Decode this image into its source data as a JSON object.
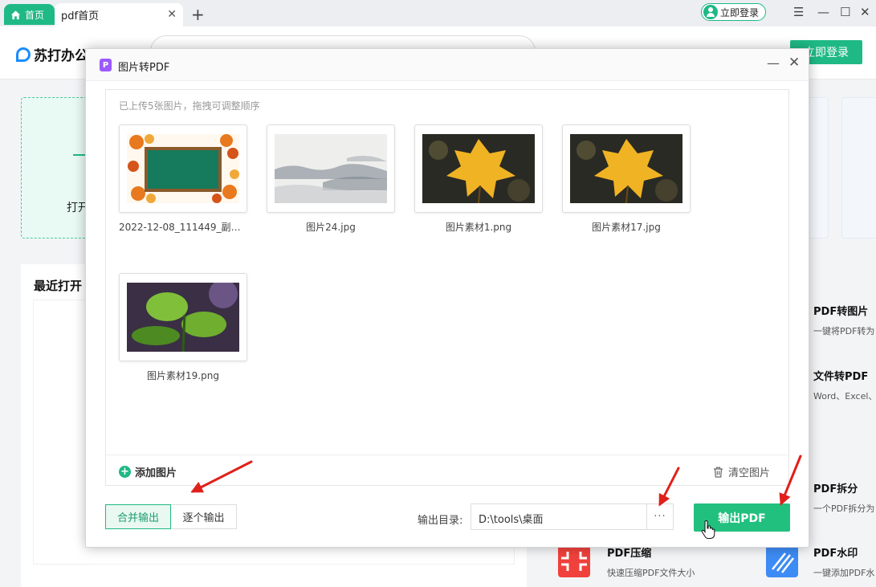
{
  "titlebar": {
    "home_tab": "首页",
    "active_tab": "pdf首页",
    "login": "立即登录"
  },
  "app": {
    "logo": "苏打办公",
    "login_button": "立即登录",
    "open_card_text": "打开",
    "recent_title": "最近打开"
  },
  "tools": [
    {
      "name": "PDF转图片",
      "desc": "一键将PDF转为"
    },
    {
      "name": "文件转PDF",
      "desc": "Word、Excel、"
    },
    {
      "name": "PDF拆分",
      "desc": "一个PDF拆分为"
    },
    {
      "name": "PDF压缩",
      "desc": "快速压缩PDF文件大小"
    },
    {
      "name": "PDF水印",
      "desc": "一键添加PDF水"
    }
  ],
  "modal": {
    "title": "图片转PDF",
    "hint": "已上传5张图片，拖拽可调整顺序",
    "images": [
      {
        "caption": "2022-12-08_111449_副本...."
      },
      {
        "caption": "图片24.jpg"
      },
      {
        "caption": "图片素材1.png"
      },
      {
        "caption": "图片素材17.jpg"
      },
      {
        "caption": "图片素材19.png"
      }
    ],
    "add_label": "添加图片",
    "clear_label": "清空图片",
    "merge_label": "合并输出",
    "single_label": "逐个输出",
    "output_dir_label": "输出目录:",
    "output_path": "D:\\tools\\桌面",
    "browse_label": "···",
    "export_label": "输出PDF"
  },
  "colors": {
    "brand_green": "#1fb986",
    "export_green": "#22c07f",
    "annotation_red": "#e0201b"
  }
}
